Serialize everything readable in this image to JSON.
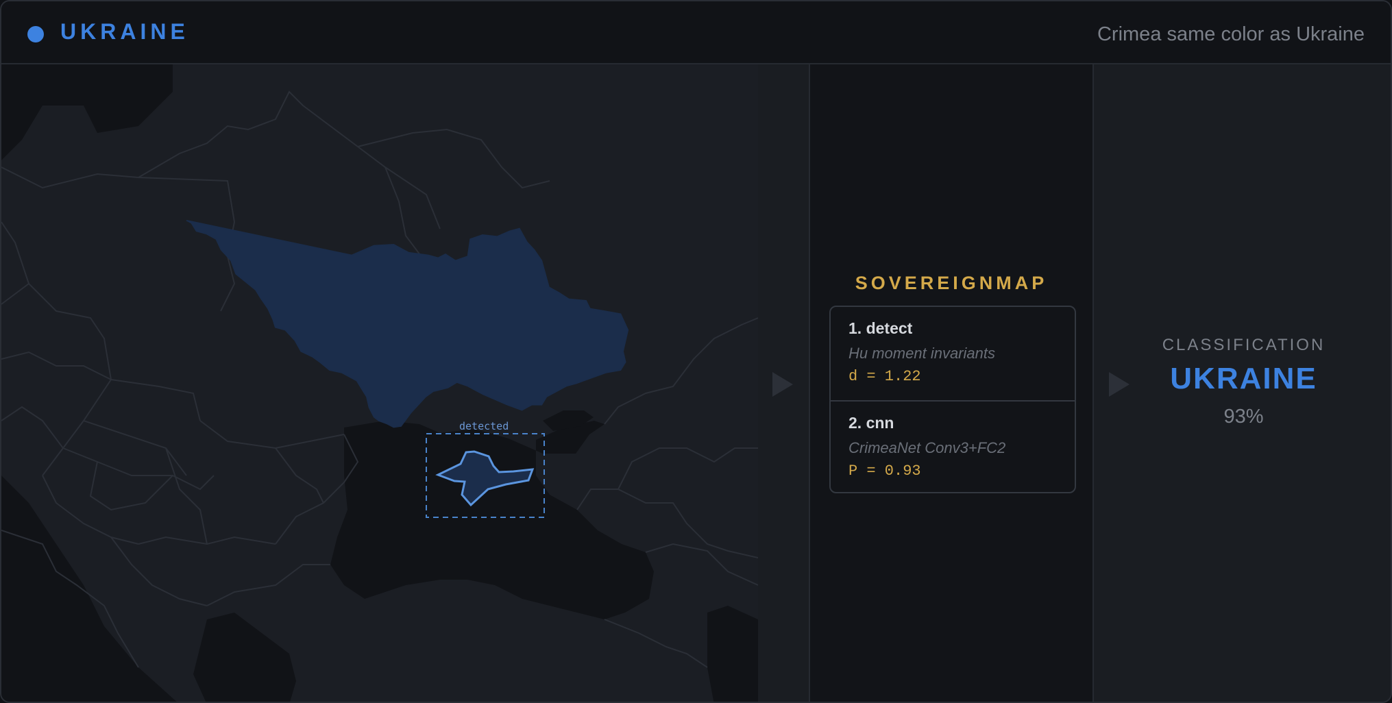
{
  "header": {
    "title": "UKRAINE",
    "caption": "Crimea same color as Ukraine"
  },
  "map": {
    "detection_label": "detected",
    "highlight_color": "#1b2d4b",
    "detection_color": "#5b95df"
  },
  "pipeline": {
    "title": "SOVEREIGNMAP",
    "steps": [
      {
        "name": "1. detect",
        "method": "Hu moment invariants",
        "metric": "d = 1.22"
      },
      {
        "name": "2. cnn",
        "method": "CrimeaNet Conv3+FC2",
        "metric": "P = 0.93"
      }
    ]
  },
  "result": {
    "label": "CLASSIFICATION",
    "value": "UKRAINE",
    "confidence": "93%"
  },
  "colors": {
    "accent": "#3d82e0",
    "gold": "#d4a94a"
  }
}
